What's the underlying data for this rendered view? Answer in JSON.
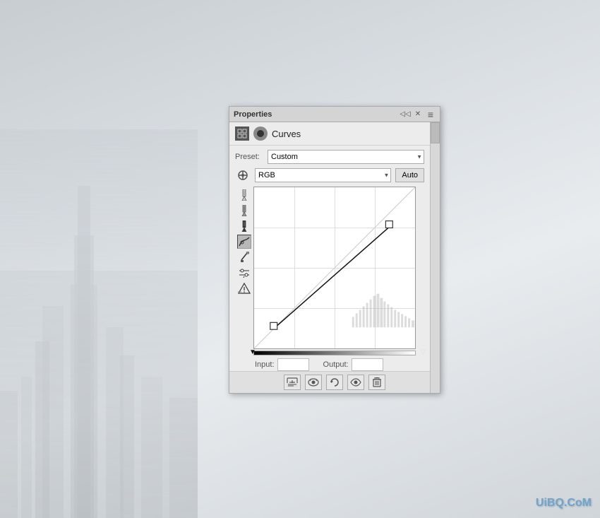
{
  "background": {
    "color": "#b8bec4"
  },
  "panel": {
    "title": "Properties",
    "section": "Curves",
    "preset_label": "Preset:",
    "preset_value": "Custom",
    "channel_value": "RGB",
    "auto_label": "Auto",
    "input_label": "Input:",
    "output_label": "Output:",
    "input_value": "",
    "output_value": ""
  },
  "toolbar": {
    "buttons": [
      {
        "name": "clip-to-layer",
        "icon": "⬛"
      },
      {
        "name": "previous-state",
        "icon": "◉"
      },
      {
        "name": "reset",
        "icon": "↺"
      },
      {
        "name": "visibility",
        "icon": "👁"
      },
      {
        "name": "delete",
        "icon": "🗑"
      }
    ]
  },
  "tools": [
    {
      "name": "pointer-tool",
      "icon": "↖",
      "active": false
    },
    {
      "name": "white-point",
      "icon": "✦",
      "active": false
    },
    {
      "name": "gray-point",
      "icon": "✦",
      "active": false
    },
    {
      "name": "black-point",
      "icon": "✦",
      "active": false
    },
    {
      "name": "curves-tool",
      "icon": "〜",
      "active": true
    },
    {
      "name": "brush-tool",
      "icon": "✏",
      "active": false
    },
    {
      "name": "mask-tool",
      "icon": "⬡",
      "active": false
    },
    {
      "name": "warning-tool",
      "icon": "⚠",
      "active": false
    }
  ],
  "watermark": "UiBQ.CoM"
}
